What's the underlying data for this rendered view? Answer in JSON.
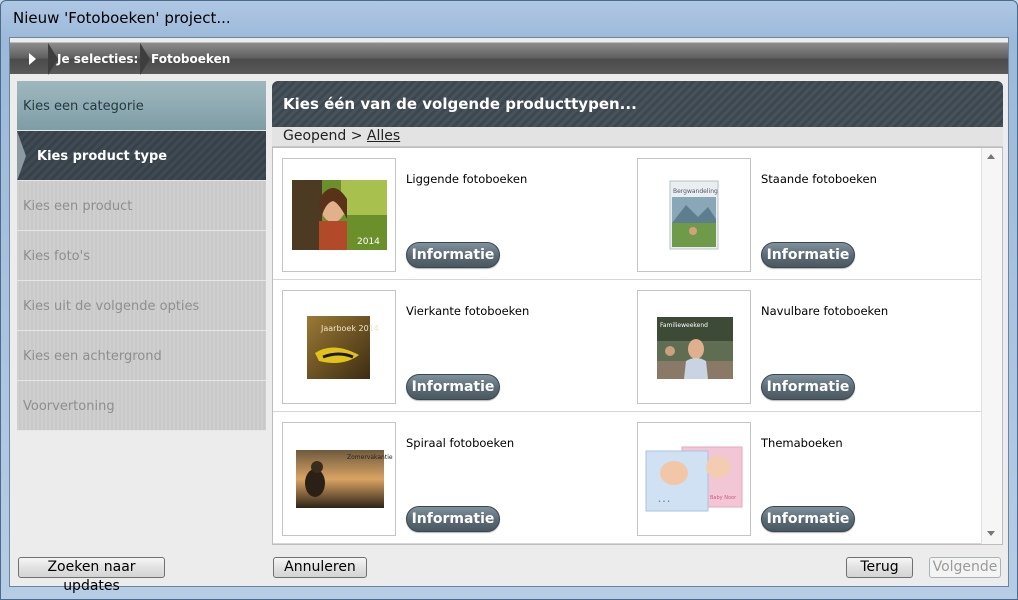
{
  "window": {
    "title": "Nieuw 'Fotoboeken' project..."
  },
  "breadcrumb": {
    "label": "Je selecties:",
    "value": "Fotoboeken"
  },
  "steps": [
    {
      "label": "Kies een categorie",
      "state": "done"
    },
    {
      "label": "Kies product type",
      "state": "active"
    },
    {
      "label": "Kies een product",
      "state": "pending"
    },
    {
      "label": "Kies foto's",
      "state": "pending"
    },
    {
      "label": "Kies uit de volgende opties",
      "state": "pending"
    },
    {
      "label": "Kies een achtergrond",
      "state": "pending"
    },
    {
      "label": "Voorvertoning",
      "state": "pending"
    }
  ],
  "main": {
    "title": "Kies één van de volgende producttypen...",
    "path_prefix": "Geopend >",
    "path_link": "Alles"
  },
  "products": [
    {
      "name": "Liggende fotoboeken",
      "button": "Informatie",
      "cover_text": "2014"
    },
    {
      "name": "Staande fotoboeken",
      "button": "Informatie",
      "cover_text": "Bergwandeling"
    },
    {
      "name": "Vierkante fotoboeken",
      "button": "Informatie",
      "cover_text": "Jaarboek 2014"
    },
    {
      "name": "Navulbare fotoboeken",
      "button": "Informatie",
      "cover_text": "Familieweekend"
    },
    {
      "name": "Spiraal fotoboeken",
      "button": "Informatie",
      "cover_text": "Zomervakantie"
    },
    {
      "name": "Themaboeken",
      "button": "Informatie",
      "cover_text": "Baby Noor"
    }
  ],
  "footer": {
    "updates": "Zoeken naar updates",
    "cancel": "Annuleren",
    "back": "Terug",
    "next": "Volgende"
  },
  "colors": {
    "header_dark": "#3d474f",
    "info_button": "#5a6a74",
    "step_done": "#8fa9b1"
  }
}
